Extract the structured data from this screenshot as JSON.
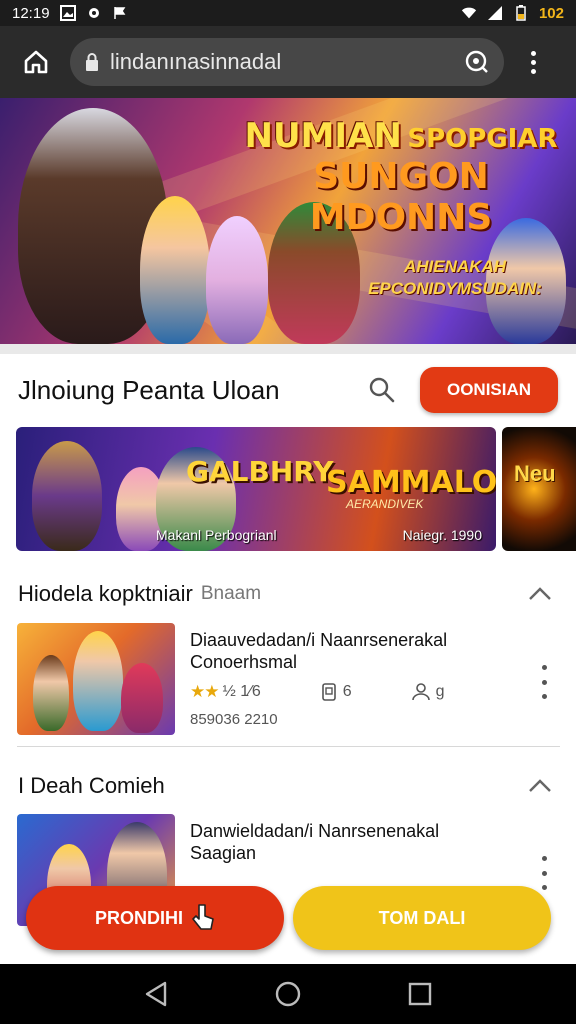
{
  "status_bar": {
    "time": "12:19",
    "battery": "102"
  },
  "browser": {
    "url": "lindanınasinnadal",
    "icons": [
      "home-icon",
      "lock-icon",
      "lens-icon",
      "more-vert-icon"
    ]
  },
  "hero": {
    "title_1": "NUMIAN",
    "title_1b": "SPOPGIAR",
    "title_2": "SUNGON MDONNS",
    "caption": "AHIENAKAH EPCONIDYMSUDAIN:"
  },
  "section": {
    "title": "Jlnoiung Peanta Uloan",
    "cta_label": "OONISIAN"
  },
  "carousel": {
    "card_title_a": "GALBHRY",
    "card_title_b": "SAMMALOU",
    "card_subtitle": "AERANDIVEK",
    "card_caption_left": "Makanl Perbogrianl",
    "card_caption_right": "Naiegr. 1990",
    "next_card_title": "Neu"
  },
  "list1": {
    "title": "Hiodela kopktniair",
    "subtitle": "Bnaam",
    "item": {
      "title": "Diaauvedadan/i Naanrsenerakal Conoerhsmal",
      "rating_stars": "★★",
      "rating_text": "½ 1⁄6",
      "stat_1": "6",
      "stat_2": "g",
      "sub": "859036 2210"
    }
  },
  "list2": {
    "title": "I Deah Comieh",
    "item": {
      "title": "Danwieldadan/i Nanrsenenakal Saagian"
    }
  },
  "buttons": {
    "primary_label": "PRONDIHI",
    "secondary_label": "TOM DALI"
  },
  "colors": {
    "primary_red": "#e03312",
    "accent_yellow": "#f0c419",
    "star": "#e8a80c"
  }
}
